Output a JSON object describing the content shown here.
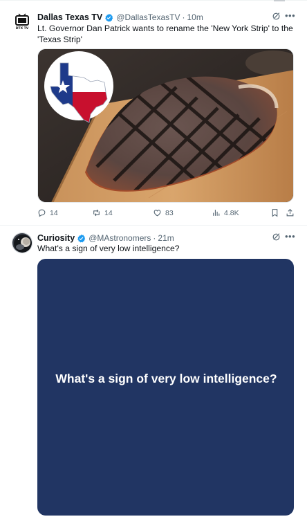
{
  "tweets": [
    {
      "name": "Dallas Texas TV",
      "handle": "@DallasTexasTV",
      "separator": "·",
      "time": "10m",
      "text": "Lt. Governor Dan Patrick wants to rename the 'New York Strip' to the 'Texas Strip'",
      "avatar_label": "DTX TV",
      "media": "photo of a grilled steak on a wooden board with a Texas flag state badge",
      "actions": {
        "replies": "14",
        "retweets": "14",
        "likes": "83",
        "views": "4.8K"
      }
    },
    {
      "name": "Curiosity",
      "handle": "@MAstronomers",
      "separator": "·",
      "time": "21m",
      "text": "What's a sign of very low intelligence?",
      "media_text": "What's a sign of very low intelligence?"
    }
  ],
  "colors": {
    "verified": "#1d9bf0",
    "secondary_text": "#536471",
    "card_background": "#213563",
    "texas_blue": "#1e3a8a",
    "texas_red": "#c8102e"
  },
  "icons": [
    "verified-badge-icon",
    "grok-icon",
    "more-icon",
    "reply-icon",
    "retweet-icon",
    "like-icon",
    "views-icon",
    "bookmark-icon",
    "share-icon"
  ]
}
